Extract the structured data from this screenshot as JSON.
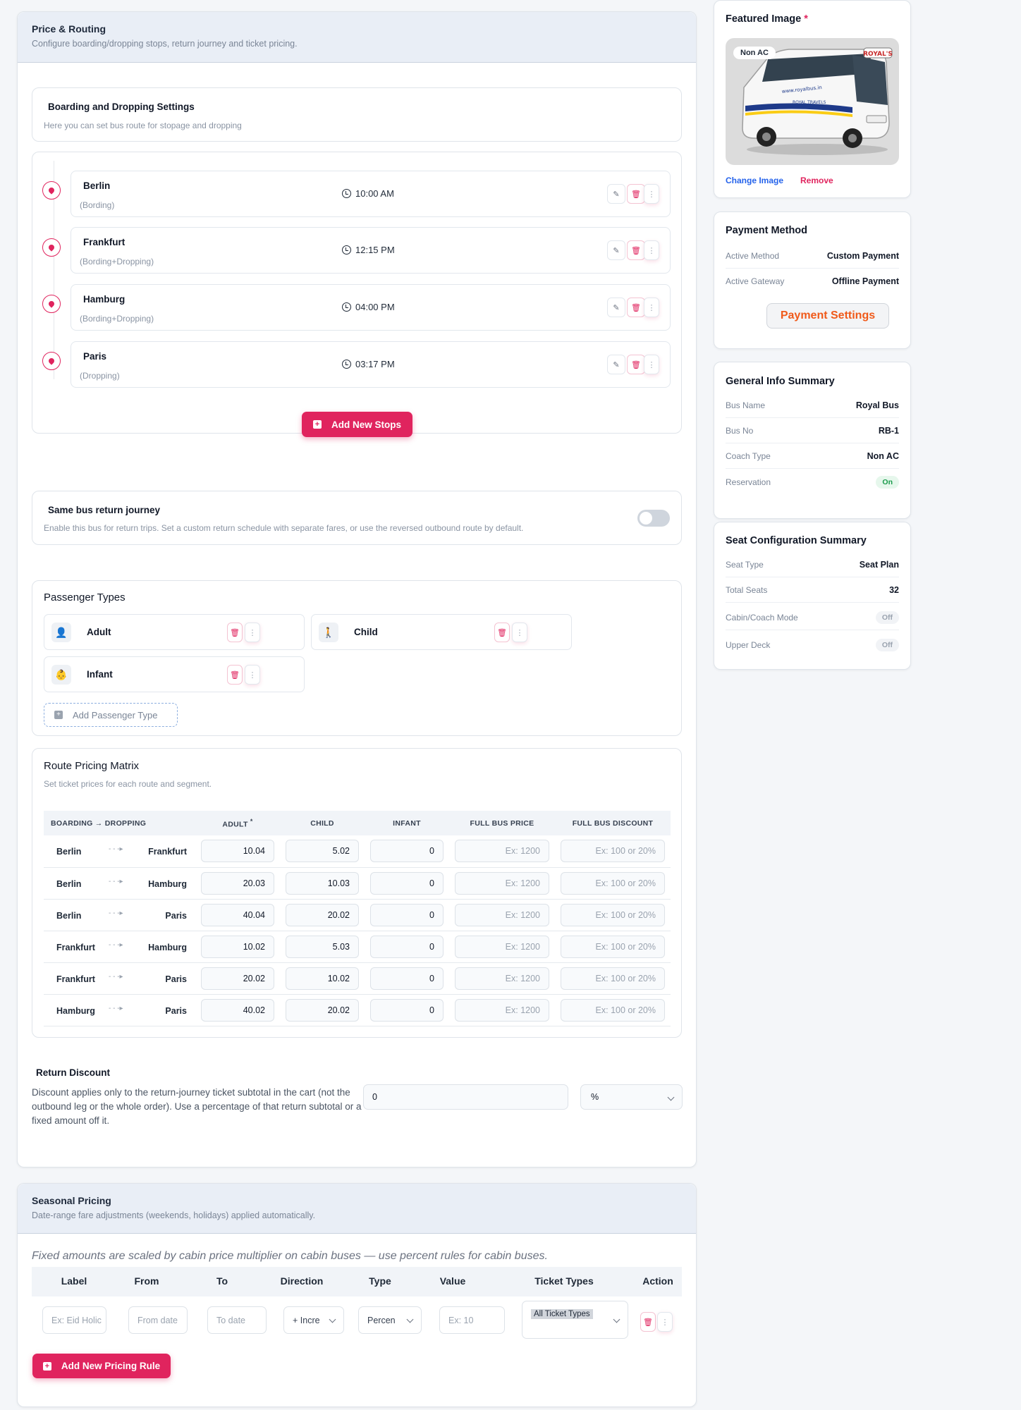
{
  "price_routing": {
    "title": "Price & Routing",
    "subtitle": "Configure boarding/dropping stops, return journey and ticket pricing."
  },
  "boarding": {
    "title": "Boarding and Dropping Settings",
    "subtitle": "Here you can set bus route for stopage and dropping"
  },
  "stops": [
    {
      "name": "Berlin",
      "type": "(Bording)",
      "time": "10:00 AM"
    },
    {
      "name": "Frankfurt",
      "type": "(Bording+Dropping)",
      "time": "12:15 PM"
    },
    {
      "name": "Hamburg",
      "type": "(Bording+Dropping)",
      "time": "04:00 PM"
    },
    {
      "name": "Paris",
      "type": "(Dropping)",
      "time": "03:17 PM"
    }
  ],
  "add_stop_label": "Add New Stops",
  "return_journey": {
    "title": "Same bus return journey",
    "desc": "Enable this bus for return trips. Set a custom return schedule with separate fares, or use the reversed outbound route by default."
  },
  "passenger_types": {
    "title": "Passenger Types",
    "items": [
      "Adult",
      "Child",
      "Infant"
    ],
    "add_label": "Add Passenger Type"
  },
  "pricing_matrix": {
    "title": "Route Pricing Matrix",
    "subtitle": "Set ticket prices for each route and segment.",
    "headers": [
      "BOARDING → DROPPING",
      "ADULT",
      "CHILD",
      "INFANT",
      "FULL BUS PRICE",
      "FULL BUS DISCOUNT"
    ],
    "required_mark": "*",
    "full_price_placeholder": "Ex: 1200",
    "discount_placeholder": "Ex: 100 or 20%",
    "rows": [
      {
        "from": "Berlin",
        "to": "Frankfurt",
        "adult": "10.04",
        "child": "5.02",
        "infant": "0"
      },
      {
        "from": "Berlin",
        "to": "Hamburg",
        "adult": "20.03",
        "child": "10.03",
        "infant": "0"
      },
      {
        "from": "Berlin",
        "to": "Paris",
        "adult": "40.04",
        "child": "20.02",
        "infant": "0"
      },
      {
        "from": "Frankfurt",
        "to": "Hamburg",
        "adult": "10.02",
        "child": "5.03",
        "infant": "0"
      },
      {
        "from": "Frankfurt",
        "to": "Paris",
        "adult": "20.02",
        "child": "10.02",
        "infant": "0"
      },
      {
        "from": "Hamburg",
        "to": "Paris",
        "adult": "40.02",
        "child": "20.02",
        "infant": "0"
      }
    ]
  },
  "return_discount": {
    "title": "Return Discount",
    "desc": "Discount applies only to the return-journey ticket subtotal in the cart (not the outbound leg or the whole order). Use a percentage of that return subtotal or a fixed amount off it.",
    "value": "0",
    "unit": "%"
  },
  "seasonal": {
    "title": "Seasonal Pricing",
    "subtitle": "Date-range fare adjustments (weekends, holidays) applied automatically.",
    "note": "Fixed amounts are scaled by cabin price multiplier on cabin buses — use percent rules for cabin buses.",
    "headers": [
      "Label",
      "From",
      "To",
      "Direction",
      "Type",
      "Value",
      "Ticket Types",
      "Action"
    ],
    "label_placeholder": "Ex: Eid Holic",
    "from_placeholder": "From date",
    "to_placeholder": "To date",
    "direction": "+ Incre",
    "type": "Percen",
    "value_placeholder": "Ex: 10",
    "ticket_types": "All Ticket Types",
    "add_label": "Add New Pricing Rule"
  },
  "featured_image": {
    "title": "Featured Image",
    "required": "*",
    "badge": "Non AC",
    "bus_brand": "ROYAL'S",
    "bus_url": "www.royalbus.in",
    "bus_side": "ROYAL TRAVELS",
    "change": "Change Image",
    "remove": "Remove"
  },
  "payment": {
    "title": "Payment Method",
    "rows": [
      {
        "k": "Active Method",
        "v": "Custom Payment"
      },
      {
        "k": "Active Gateway",
        "v": "Offline Payment"
      }
    ],
    "button": "Payment Settings"
  },
  "general": {
    "title": "General Info Summary",
    "rows": [
      {
        "k": "Bus Name",
        "v": "Royal Bus"
      },
      {
        "k": "Bus No",
        "v": "RB-1"
      },
      {
        "k": "Coach Type",
        "v": "Non AC"
      },
      {
        "k": "Reservation",
        "v": "On"
      }
    ]
  },
  "seat": {
    "title": "Seat Configuration Summary",
    "rows": [
      {
        "k": "Seat Type",
        "v": "Seat Plan"
      },
      {
        "k": "Total Seats",
        "v": "32"
      },
      {
        "k": "Cabin/Coach Mode",
        "v": "Off"
      },
      {
        "k": "Upper Deck",
        "v": "Off"
      }
    ]
  },
  "colors": {
    "accent": "#e0245e",
    "link": "#2563eb",
    "orange": "#f05a1a"
  }
}
